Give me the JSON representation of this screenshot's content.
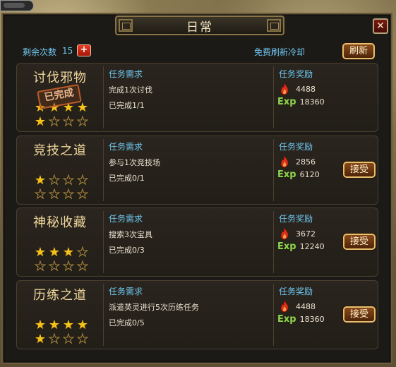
{
  "window": {
    "title": "日常",
    "close_label": "✕"
  },
  "header": {
    "remaining_label": "剩余次数",
    "remaining_count": "15",
    "add_label": "+",
    "refresh_cooldown_label": "免费刷新冷却",
    "refresh_button": "刷新"
  },
  "labels": {
    "requirement": "任务需求",
    "reward": "任务奖励",
    "exp": "Exp",
    "accept": "接受",
    "completed_stamp": "已完成"
  },
  "colors": {
    "accent_blue": "#6ec6f0",
    "title_gold": "#f1d79c",
    "star_gold": "#f5c21b",
    "exp_green": "#8fd14f"
  },
  "tasks": [
    {
      "name": "讨伐邪物",
      "stars_filled": 5,
      "stars_total": 8,
      "completed": true,
      "requirement": "完成1次讨伐",
      "progress": "已完成1/1",
      "reward_flame": "4488",
      "reward_exp": "18360"
    },
    {
      "name": "竞技之道",
      "stars_filled": 1,
      "stars_total": 8,
      "completed": false,
      "requirement": "参与1次竞技场",
      "progress": "已完成0/1",
      "reward_flame": "2856",
      "reward_exp": "6120"
    },
    {
      "name": "神秘收藏",
      "stars_filled": 3,
      "stars_total": 8,
      "completed": false,
      "requirement": "搜索3次宝具",
      "progress": "已完成0/3",
      "reward_flame": "3672",
      "reward_exp": "12240"
    },
    {
      "name": "历练之道",
      "stars_filled": 5,
      "stars_total": 8,
      "completed": false,
      "requirement": "派遣英灵进行5次历练任务",
      "progress": "已完成0/5",
      "reward_flame": "4488",
      "reward_exp": "18360"
    }
  ]
}
